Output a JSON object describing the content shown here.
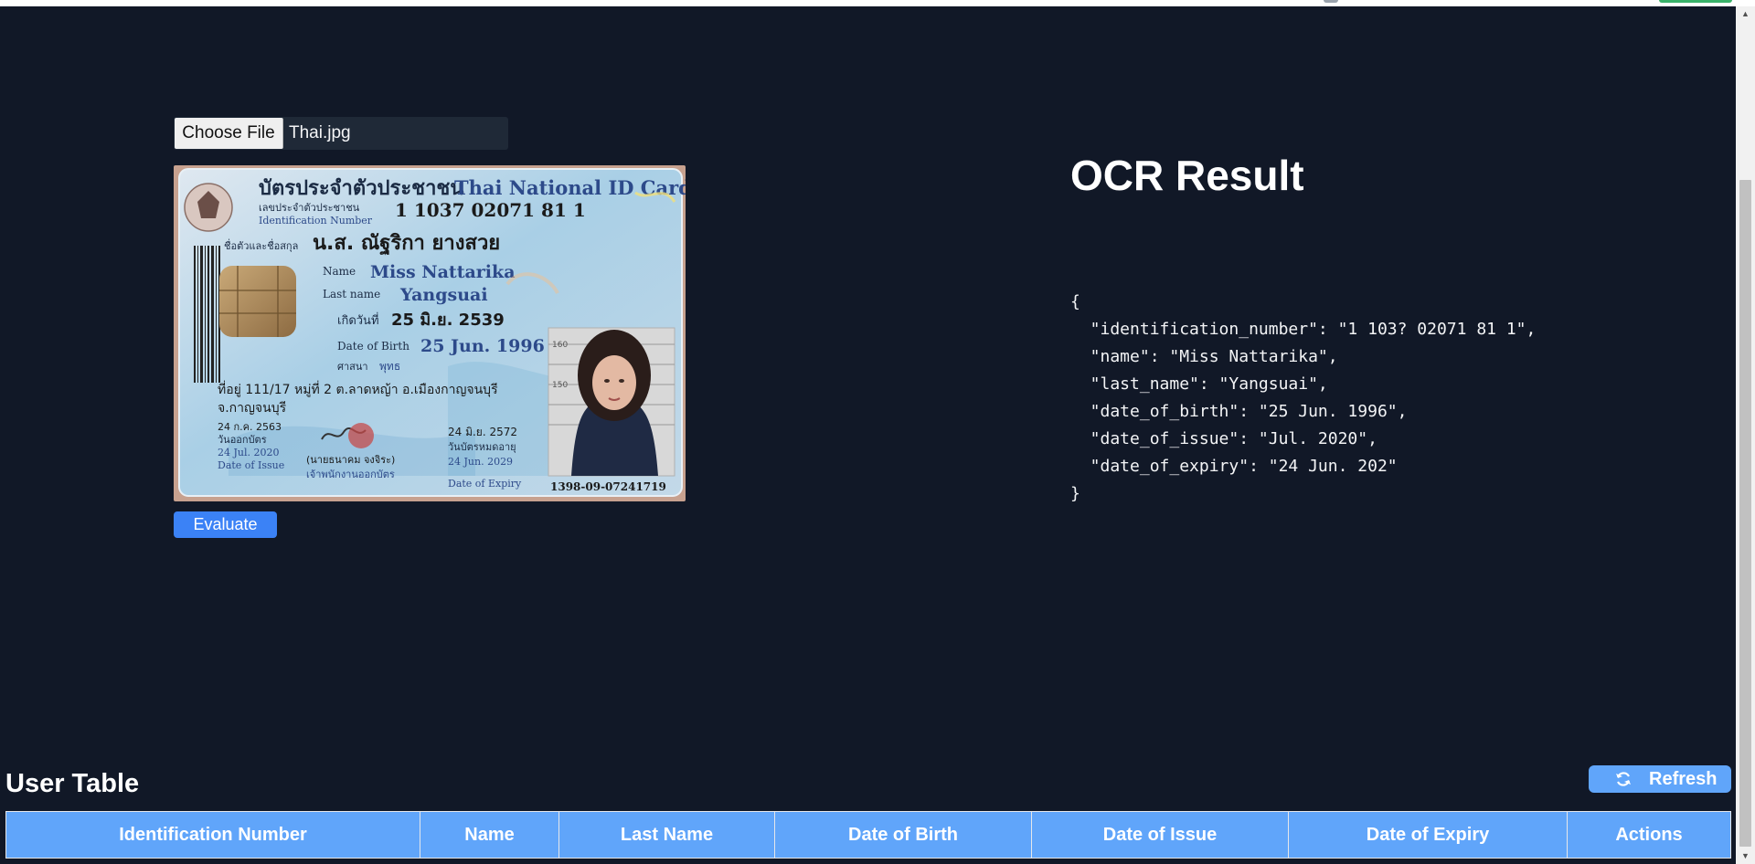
{
  "upload": {
    "choose_file_label": "Choose File",
    "file_name": "Thai.jpg"
  },
  "id_card": {
    "title_th": "บัตรประจำตัวประชาชน",
    "title_en": "Thai National ID Card",
    "id_label_th": "เลขประจำตัวประชาชน",
    "id_label_en": "Identification Number",
    "id_number": "1 1037 02071 81 1",
    "name_label_th": "ชื่อตัวและชื่อสกุล",
    "name_th": "น.ส. ณัฐริกา ยางสวย",
    "name_label_en": "Name",
    "name_en": "Miss Nattarika",
    "last_name_label_en": "Last name",
    "last_name_en": "Yangsuai",
    "dob_label_th": "เกิดวันที่",
    "dob_th": "25 มิ.ย. 2539",
    "dob_label_en": "Date of Birth",
    "dob_en": "25 Jun. 1996",
    "religion_label": "ศาสนา",
    "religion": "พุทธ",
    "address_line1": "ที่อยู่ 111/17 หมู่ที่ 2 ต.ลาดหญ้า อ.เมืองกาญจนบุรี",
    "address_line2": "จ.กาญจนบุรี",
    "issue_th": "24 ก.ค. 2563",
    "issue_label_th": "วันออกบัตร",
    "issue_en": "24 Jul. 2020",
    "issue_label_en": "Date of Issue",
    "officer_th": "(นายธนาคม จงจิระ)",
    "officer_title": "เจ้าพนักงานออกบัตร",
    "expiry_th": "24 มิ.ย. 2572",
    "expiry_label_th": "วันบัตรหมดอายุ",
    "expiry_en": "24 Jun. 2029",
    "expiry_label_en": "Date of Expiry",
    "serial": "1398-09-07241719",
    "height_marks": [
      "160",
      "150"
    ]
  },
  "evaluate_label": "Evaluate",
  "ocr": {
    "title": "OCR Result",
    "json_lines": [
      "{",
      "  \"identification_number\": \"1 103? 02071 81 1\",",
      "  \"name\": \"Miss Nattarika\",",
      "  \"last_name\": \"Yangsuai\",",
      "  \"date_of_birth\": \"25 Jun. 1996\",",
      "  \"date_of_issue\": \"Jul. 2020\",",
      "  \"date_of_expiry\": \"24 Jun. 202\"",
      "}"
    ]
  },
  "user_table": {
    "title": "User Table",
    "refresh_label": "Refresh",
    "columns": [
      "Identification Number",
      "Name",
      "Last Name",
      "Date of Birth",
      "Date of Issue",
      "Date of Expiry",
      "Actions"
    ]
  },
  "colors": {
    "background": "#111827",
    "accent": "#3b82f6",
    "table_header": "#60a5fa"
  }
}
